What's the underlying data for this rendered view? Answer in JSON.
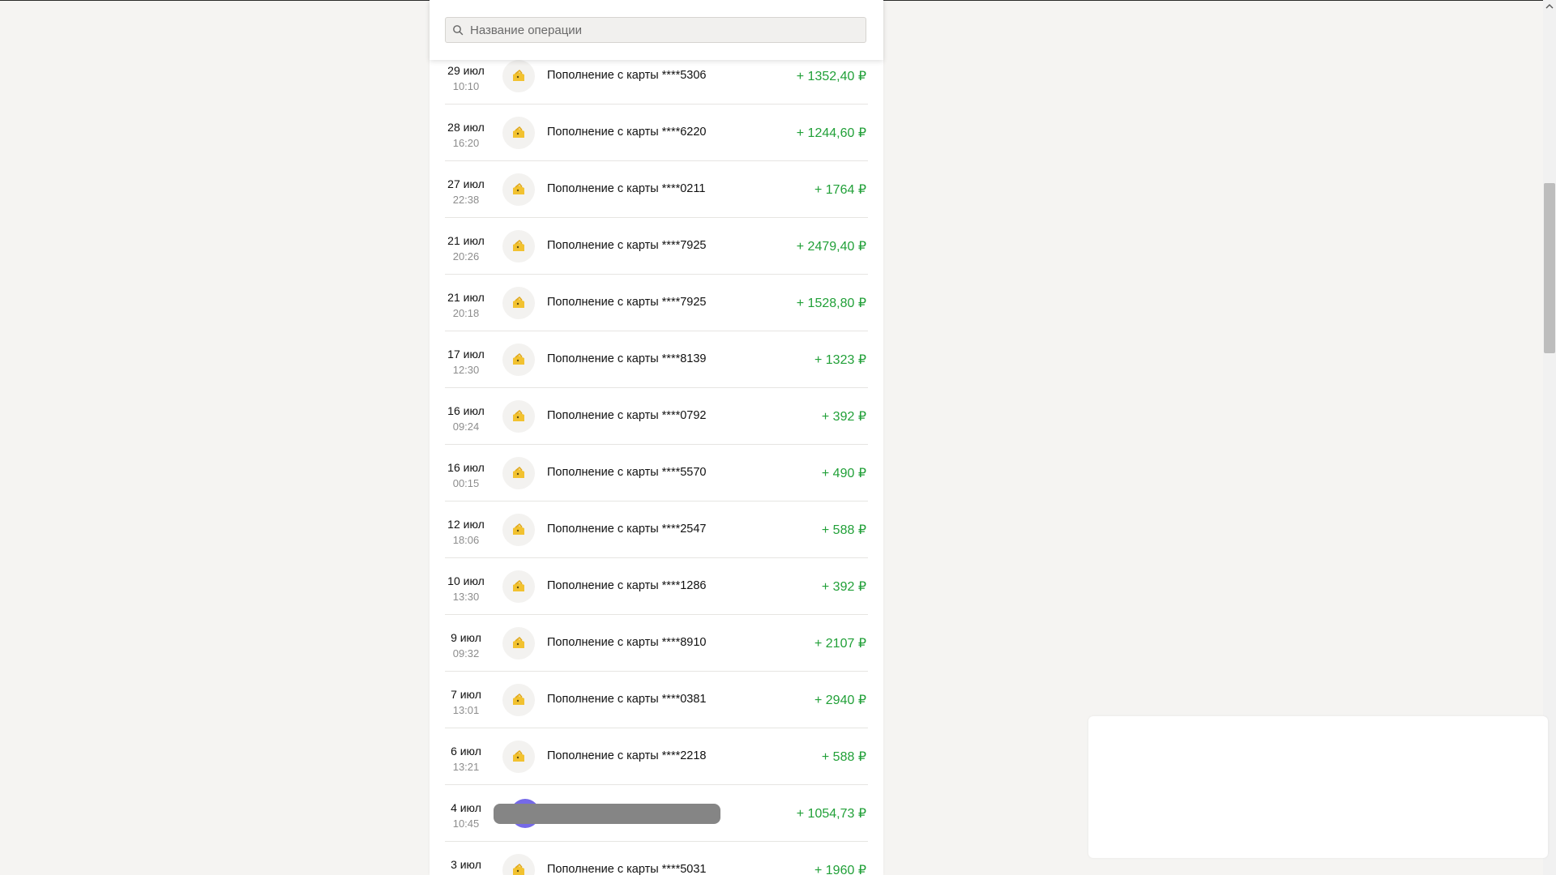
{
  "search": {
    "placeholder": "Название операции",
    "icon": "search-icon"
  },
  "operations": [
    {
      "date": "29 июл",
      "time": "10:10",
      "description": "Пополнение с карты ****5306",
      "amount": "+ 1352,40 ₽",
      "icon": "wallet-icon"
    },
    {
      "date": "28 июл",
      "time": "16:20",
      "description": "Пополнение с карты ****6220",
      "amount": "+ 1244,60 ₽",
      "icon": "wallet-icon"
    },
    {
      "date": "27 июл",
      "time": "22:38",
      "description": "Пополнение с карты ****0211",
      "amount": "+ 1764 ₽",
      "icon": "wallet-icon"
    },
    {
      "date": "21 июл",
      "time": "20:26",
      "description": "Пополнение с карты ****7925",
      "amount": "+ 2479,40 ₽",
      "icon": "wallet-icon"
    },
    {
      "date": "21 июл",
      "time": "20:18",
      "description": "Пополнение с карты ****7925",
      "amount": "+ 1528,80 ₽",
      "icon": "wallet-icon"
    },
    {
      "date": "17 июл",
      "time": "12:30",
      "description": "Пополнение с карты ****8139",
      "amount": "+ 1323 ₽",
      "icon": "wallet-icon"
    },
    {
      "date": "16 июл",
      "time": "09:24",
      "description": "Пополнение с карты ****0792",
      "amount": "+ 392 ₽",
      "icon": "wallet-icon"
    },
    {
      "date": "16 июл",
      "time": "00:15",
      "description": "Пополнение с карты ****5570",
      "amount": "+ 490 ₽",
      "icon": "wallet-icon"
    },
    {
      "date": "12 июл",
      "time": "18:06",
      "description": "Пополнение с карты ****2547",
      "amount": "+ 588 ₽",
      "icon": "wallet-icon"
    },
    {
      "date": "10 июл",
      "time": "13:30",
      "description": "Пополнение с карты ****1286",
      "amount": "+ 392 ₽",
      "icon": "wallet-icon"
    },
    {
      "date": "9 июл",
      "time": "09:32",
      "description": "Пополнение с карты ****8910",
      "amount": "+ 2107 ₽",
      "icon": "wallet-icon"
    },
    {
      "date": "7 июл",
      "time": "13:01",
      "description": "Пополнение с карты ****0381",
      "amount": "+ 2940 ₽",
      "icon": "wallet-icon"
    },
    {
      "date": "6 июл",
      "time": "13:21",
      "description": "Пополнение с карты ****2218",
      "amount": "+ 588 ₽",
      "icon": "wallet-icon"
    },
    {
      "date": "4 июл",
      "time": "10:45",
      "description": "",
      "amount": "+ 1054,73 ₽",
      "icon": "redacted",
      "redacted": true
    },
    {
      "date": "3 июл",
      "time": "",
      "description": "Пополнение с карты ****5031",
      "amount": "+ 1960 ₽",
      "icon": "wallet-icon"
    }
  ],
  "colors": {
    "background": "#f5f4f2",
    "panel": "#ffffff",
    "amount_positive": "#21a038",
    "icon_yellow": "#f2c230",
    "redaction_circle": "#7569e8",
    "redaction_bar": "#858585"
  }
}
